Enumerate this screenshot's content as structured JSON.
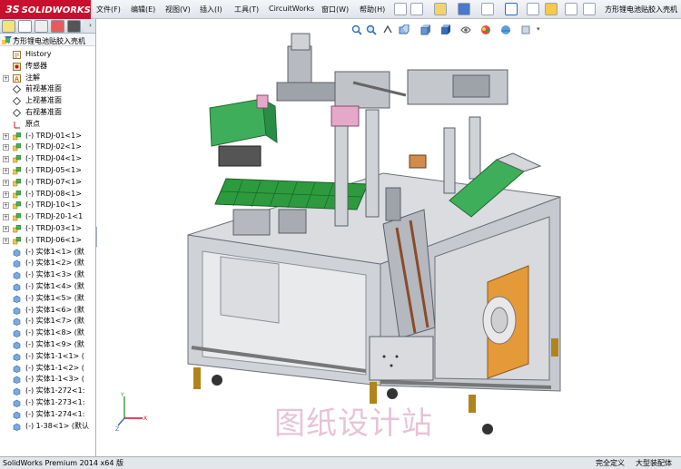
{
  "app": {
    "logo_text": "SOLIDWORKS",
    "logo_prefix": "3S",
    "brand_color": "#c8102e"
  },
  "menu": [
    {
      "label": "文件(F)"
    },
    {
      "label": "编辑(E)"
    },
    {
      "label": "视图(V)"
    },
    {
      "label": "插入(I)"
    },
    {
      "label": "工具(T)"
    },
    {
      "label": "CircuitWorks"
    },
    {
      "label": "窗口(W)"
    },
    {
      "label": "帮助(H)"
    }
  ],
  "document_title": "方形锂电池贴胶入壳机",
  "tree": {
    "root": "方形锂电池贴胶入壳机",
    "items": [
      {
        "label": "History",
        "icon": "history-icon",
        "expander": false
      },
      {
        "label": "传感器",
        "icon": "sensor-icon",
        "expander": false
      },
      {
        "label": "注解",
        "icon": "annotation-icon",
        "expander": true
      },
      {
        "label": "前视基准面",
        "icon": "plane-icon",
        "expander": false
      },
      {
        "label": "上视基准面",
        "icon": "plane-icon",
        "expander": false
      },
      {
        "label": "右视基准面",
        "icon": "plane-icon",
        "expander": false
      },
      {
        "label": "原点",
        "icon": "origin-icon",
        "expander": false
      },
      {
        "label": "(-) TRDJ-01<1>",
        "icon": "assembly-icon",
        "expander": true
      },
      {
        "label": "(-) TRDJ-02<1>",
        "icon": "assembly-icon",
        "expander": true
      },
      {
        "label": "(-) TRDJ-04<1>",
        "icon": "assembly-icon",
        "expander": true
      },
      {
        "label": "(-) TRDJ-05<1>",
        "icon": "assembly-icon",
        "expander": true
      },
      {
        "label": "(-) TRDJ-07<1>",
        "icon": "assembly-icon",
        "expander": true
      },
      {
        "label": "(-) TRDJ-08<1>",
        "icon": "assembly-icon",
        "expander": true
      },
      {
        "label": "(-) TRDJ-10<1>",
        "icon": "assembly-icon",
        "expander": true
      },
      {
        "label": "(-) TRDJ-20-1<1",
        "icon": "assembly-icon",
        "expander": true
      },
      {
        "label": "(-) TRDJ-03<1>",
        "icon": "assembly-icon",
        "expander": true
      },
      {
        "label": "(-) TRDJ-06<1>",
        "icon": "assembly-icon",
        "expander": true
      },
      {
        "label": "(-) 实体1<1> (默",
        "icon": "part-icon",
        "expander": false
      },
      {
        "label": "(-) 实体1<2> (默",
        "icon": "part-icon",
        "expander": false
      },
      {
        "label": "(-) 实体1<3> (默",
        "icon": "part-icon",
        "expander": false
      },
      {
        "label": "(-) 实体1<4> (默",
        "icon": "part-icon",
        "expander": false
      },
      {
        "label": "(-) 实体1<5> (默",
        "icon": "part-icon",
        "expander": false
      },
      {
        "label": "(-) 实体1<6> (默",
        "icon": "part-icon",
        "expander": false
      },
      {
        "label": "(-) 实体1<7> (默",
        "icon": "part-icon",
        "expander": false
      },
      {
        "label": "(-) 实体1<8> (默",
        "icon": "part-icon",
        "expander": false
      },
      {
        "label": "(-) 实体1<9> (默",
        "icon": "part-icon",
        "expander": false
      },
      {
        "label": "(-) 实体1-1<1> (",
        "icon": "part-icon",
        "expander": false
      },
      {
        "label": "(-) 实体1-1<2> (",
        "icon": "part-icon",
        "expander": false
      },
      {
        "label": "(-) 实体1-1<3> (",
        "icon": "part-icon",
        "expander": false
      },
      {
        "label": "(-) 实体1-272<1:",
        "icon": "part-icon",
        "expander": false
      },
      {
        "label": "(-) 实体1-273<1:",
        "icon": "part-icon",
        "expander": false
      },
      {
        "label": "(-) 实体1-274<1:",
        "icon": "part-icon",
        "expander": false
      },
      {
        "label": "(-) 1-38<1> (默认",
        "icon": "part-icon",
        "expander": false
      }
    ]
  },
  "watermark": "图纸设计站",
  "status": {
    "left": "SolidWorks Premium 2014 x64 版",
    "right1": "完全定义",
    "right2": "大型装配体"
  },
  "colors": {
    "frame": "#c9ccd2",
    "green_cover": "#3fae5a",
    "pcb_green": "#2e9a3e",
    "orange_panel": "#e59a3a",
    "pink_block": "#e5a8c8",
    "accent_blue": "#2f6db5"
  }
}
